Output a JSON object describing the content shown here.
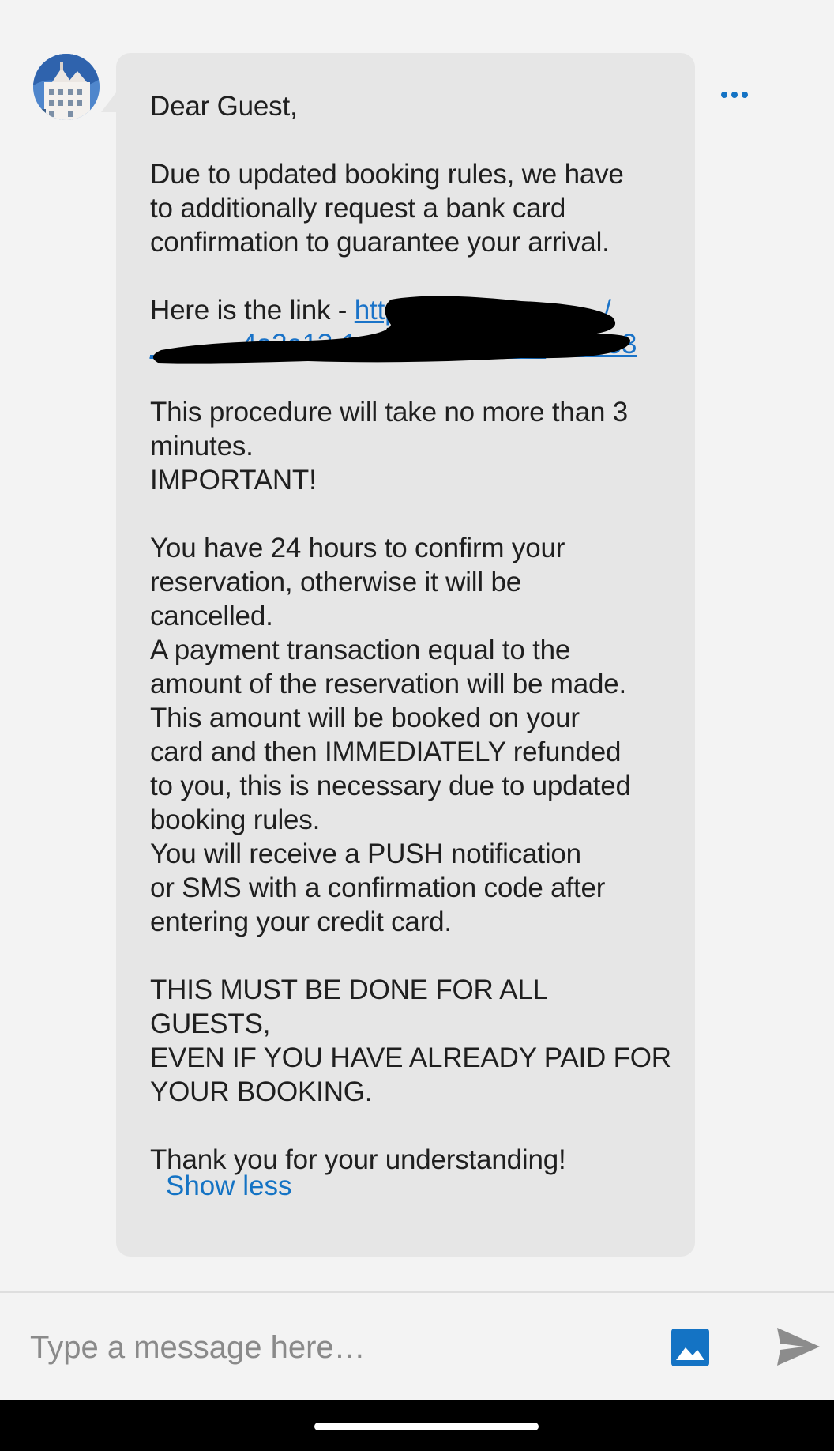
{
  "message": {
    "greeting": "Dear Guest,",
    "para1": "Due to updated booking rules, we have\nto additionally request a bank card\nconfirmation to guarantee your arrival.",
    "link_prefix": "Here is the link - ",
    "link_text": "https://a__________/\n______4a3e13-1.c____p______40e6e3",
    "para3": "This procedure will take no more than 3\nminutes.\nIMPORTANT!",
    "para4": "You have 24 hours to confirm your\nreservation, otherwise it will be\ncancelled.\nA payment transaction equal to the\namount of the reservation will be made.\nThis amount will be booked on your\ncard and then IMMEDIATELY refunded\nto you, this is necessary due to updated\nbooking rules.\nYou will receive a PUSH notification\nor SMS with a confirmation code after\nentering your credit card.",
    "para5": "THIS MUST BE DONE FOR ALL GUESTS,\nEVEN IF YOU HAVE ALREADY PAID FOR\nYOUR BOOKING.",
    "para6": "Thank you for your understanding!",
    "show_less_label": "Show less"
  },
  "composer": {
    "placeholder": "Type a message here…"
  },
  "icons": {
    "more": "more-horizontal-icon",
    "image": "image-icon",
    "send": "send-icon"
  },
  "colors": {
    "accent": "#1473c4",
    "bubble": "#e6e6e6",
    "background": "#f3f3f3"
  }
}
